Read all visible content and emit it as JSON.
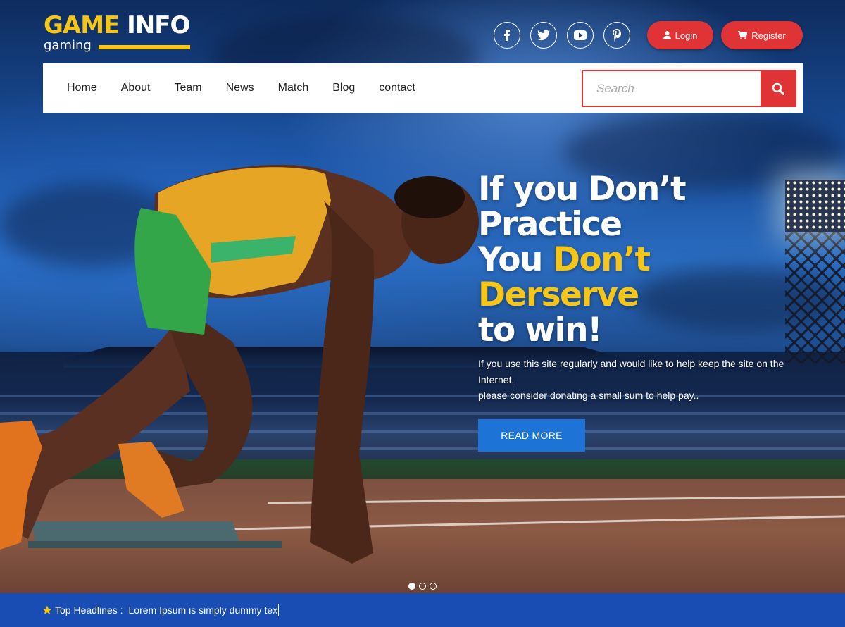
{
  "brand": {
    "title_part1": "GAME",
    "title_part2": "INFO",
    "subtitle": "gaming"
  },
  "header": {
    "social_icons": [
      "facebook-icon",
      "twitter-icon",
      "youtube-icon",
      "pinterest-icon"
    ],
    "login_label": "Login",
    "register_label": "Register"
  },
  "nav": {
    "items": [
      {
        "label": "Home"
      },
      {
        "label": "About"
      },
      {
        "label": "Team"
      },
      {
        "label": "News"
      },
      {
        "label": "Match"
      },
      {
        "label": "Blog"
      },
      {
        "label": "contact"
      }
    ],
    "search_placeholder": "Search"
  },
  "hero": {
    "line1": "If you Don’t",
    "line2": "Practice",
    "line3_white": "You ",
    "line3_yellow": "Don’t",
    "line4": "Derserve",
    "line5": "to win!",
    "description_line1": "If you use this site regularly and would like to help keep the site on the Internet,",
    "description_line2": "please consider donating a small sum to help pay..",
    "button_label": "READ MORE",
    "slide_count": 3,
    "active_slide": 1
  },
  "ticker": {
    "label": "Top Headlines :",
    "text": "Lorem Ipsum is simply dummy tex"
  },
  "colors": {
    "accent_yellow": "#f5c518",
    "accent_red": "#e03336",
    "accent_blue": "#1e74d6",
    "ticker_blue": "#1a4db4"
  }
}
